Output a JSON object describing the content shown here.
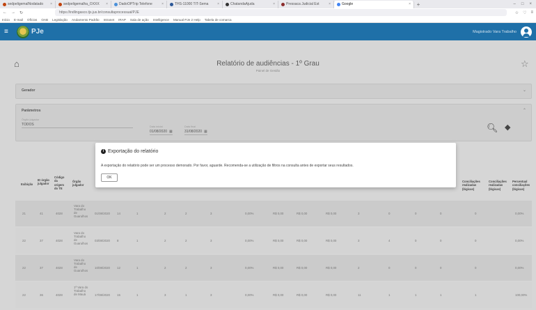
{
  "browser": {
    "tabs": [
      "sedpeligemalNodatado",
      "sedpeligemalha_OXXX",
      "DadoOPTrip Telefone",
      "THS-11000 TIT-Sema",
      "ChatandaAjuda",
      "Pressaca Judicial Est",
      "Google"
    ],
    "new_tab": "+",
    "url": "https://indlingasco.tjs.jus.br/consultaprocessual/PJE",
    "bookmarks": [
      "Início",
      "E-mail",
      "Ofícios",
      "OAB",
      "Legislação",
      "Andamento Padrão",
      "Intranet",
      "IRAP",
      "Sala de ação",
      "Intelligence",
      "Manual PJe 2 Help",
      "Tabela de comarca"
    ]
  },
  "app": {
    "logo_text": "PJe",
    "user_name": "Magistrado Vara Trabalho"
  },
  "page": {
    "title": "Relatório de audiências - 1º Grau",
    "subtitle": "Painel de Gestão"
  },
  "filters": {
    "section_title": "Gerador",
    "params_title": "Parâmetros",
    "orgao_label": "Órgão julgador",
    "orgao_value": "TODOS",
    "data_inicio_label": "Data inicial",
    "data_inicio_value": "01/08/2020",
    "data_fim_label": "Data final",
    "data_fim_value": "31/08/2020"
  },
  "table": {
    "headers": [
      "Exibição",
      "ID órgão julgador",
      "Código da origem do TE",
      "Órgão julgador",
      "",
      "",
      "",
      "",
      "",
      "",
      "",
      "",
      "",
      "",
      "",
      "",
      "",
      "Conciliações realizadas (lógicas)",
      "Conciliações realizadas (lógicas)",
      "Percentual conciliações (lógicas)"
    ],
    "rows": [
      {
        "a": "21",
        "b": "41",
        "c": "4028",
        "d": "Vara do Trabalho de Guarulhos",
        "e": "01/08/2020",
        "f": "14",
        "g": "1",
        "h": "2",
        "i": "2",
        "j": "3",
        "k": "0,00%",
        "l": "R$ 0,00",
        "m": "R$ 0,00",
        "n": "R$ 0,00",
        "o": "3",
        "p": "0",
        "q": "0",
        "r": "0",
        "s": "0",
        "t": "0,00%"
      },
      {
        "a": "22",
        "b": "37",
        "c": "4028",
        "d": "Vara do Trabalho de Guarulhos",
        "e": "03/08/2020",
        "f": "8",
        "g": "1",
        "h": "2",
        "i": "2",
        "j": "3",
        "k": "0,00%",
        "l": "R$ 0,00",
        "m": "R$ 0,00",
        "n": "R$ 0,00",
        "o": "3",
        "p": "4",
        "q": "0",
        "r": "0",
        "s": "0",
        "t": "0,00%"
      },
      {
        "a": "22",
        "b": "37",
        "c": "4028",
        "d": "Vara do Trabalho de Guarulhos",
        "e": "10/08/2020",
        "f": "12",
        "g": "1",
        "h": "2",
        "i": "2",
        "j": "3",
        "k": "0,00%",
        "l": "R$ 0,00",
        "m": "R$ 0,00",
        "n": "R$ 0,00",
        "o": "2",
        "p": "0",
        "q": "0",
        "r": "0",
        "s": "0",
        "t": "0,00%"
      },
      {
        "a": "22",
        "b": "36",
        "c": "4028",
        "d": "1ª Vara do Trabalho de Mauá",
        "e": "17/08/2020",
        "f": "15",
        "g": "1",
        "h": "3",
        "i": "1",
        "j": "3",
        "k": "0,00%",
        "l": "R$ 0,00",
        "m": "R$ 0,00",
        "n": "R$ 0,00",
        "o": "11",
        "p": "1",
        "q": "1",
        "r": "1",
        "s": "1",
        "t": "100,00%"
      }
    ]
  },
  "modal": {
    "title": "Exportação do relatório",
    "message": "A exportação do relatório pode ser um processo demorado. Por favor, aguarde. Recomenda-se a utilização de filtros na consulta antes de exportar seus resultados.",
    "ok_label": "OK"
  }
}
